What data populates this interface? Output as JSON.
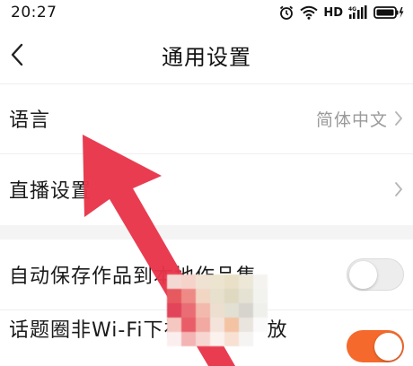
{
  "status_bar": {
    "time": "20:27",
    "hd": "HD",
    "network": "4G",
    "icons": [
      "alarm-icon",
      "wifi-icon",
      "signal-icon",
      "battery-icon"
    ]
  },
  "header": {
    "title": "通用设置",
    "back_icon": "chevron-left-icon"
  },
  "settings": {
    "language": {
      "label": "语言",
      "value": "简体中文"
    },
    "live": {
      "label": "直播设置"
    },
    "auto_save": {
      "label": "自动保存作品到本地作品集",
      "enabled": false
    },
    "topic_autoplay": {
      "label": "话题圈非Wi-Fi下视频自动播放",
      "enabled": true
    }
  },
  "colors": {
    "accent": "#f56a2c",
    "annotation_arrow": "#e8344a",
    "section_gap": "#f4f4f4",
    "secondary_text": "#9a9a9a"
  }
}
